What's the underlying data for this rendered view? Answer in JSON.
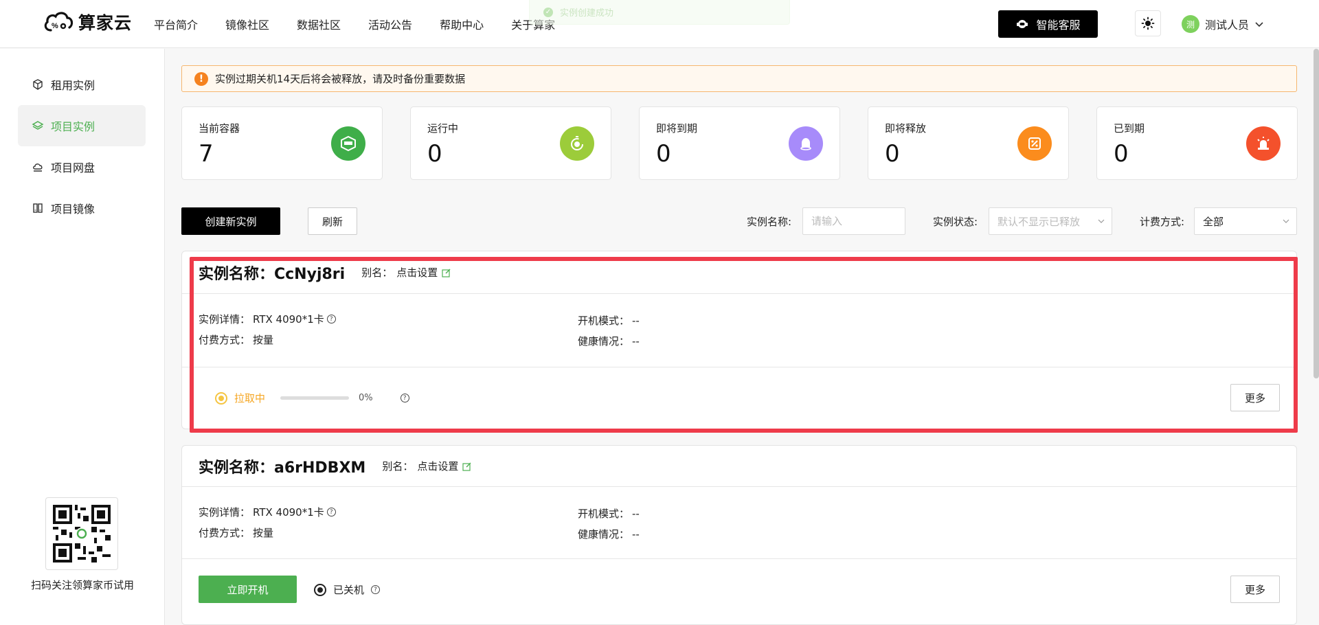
{
  "header": {
    "logo_text": "算家云",
    "nav": [
      "平台简介",
      "镜像社区",
      "数据社区",
      "活动公告",
      "帮助中心",
      "关于算家"
    ],
    "toast_text": "实例创建成功",
    "service_label": "智能客服",
    "user": {
      "avatar_text": "测",
      "name": "测试人员"
    }
  },
  "sidebar": {
    "items": [
      {
        "label": "租用实例",
        "icon": "cube-icon"
      },
      {
        "label": "项目实例",
        "icon": "layers-icon"
      },
      {
        "label": "项目网盘",
        "icon": "cloud-disk-icon"
      },
      {
        "label": "项目镜像",
        "icon": "image-stack-icon"
      }
    ],
    "qr_caption": "扫码关注领算家币试用"
  },
  "notice": "实例过期关机14天后将会被释放，请及时备份重要数据",
  "stats": [
    {
      "label": "当前容器",
      "value": "7",
      "color": "#3fae49"
    },
    {
      "label": "运行中",
      "value": "0",
      "color": "#9ccc3a"
    },
    {
      "label": "即将到期",
      "value": "0",
      "color": "#a78bfa"
    },
    {
      "label": "即将释放",
      "value": "0",
      "color": "#fb8c1d"
    },
    {
      "label": "已到期",
      "value": "0",
      "color": "#f4512c"
    }
  ],
  "toolbar": {
    "create_label": "创建新实例",
    "refresh_label": "刷新",
    "name_label": "实例名称:",
    "name_placeholder": "请输入",
    "status_label": "实例状态:",
    "status_placeholder": "默认不显示已释放",
    "billing_label": "计费方式:",
    "billing_value": "全部"
  },
  "instances": [
    {
      "title": "实例名称：CcNyj8ri",
      "alias_label": "别名：",
      "alias_link": "点击设置",
      "detail_label": "实例详情：",
      "detail_value": "RTX 4090*1卡",
      "pay_label": "付费方式：",
      "pay_value": "按量",
      "boot_label": "开机模式：",
      "boot_value": "--",
      "health_label": "健康情况：",
      "health_value": "--",
      "status": "拉取中",
      "progress_text": "0%",
      "progress": 0,
      "more_label": "更多"
    },
    {
      "title": "实例名称：a6rHDBXM",
      "alias_label": "别名：",
      "alias_link": "点击设置",
      "detail_label": "实例详情：",
      "detail_value": "RTX 4090*1卡",
      "pay_label": "付费方式：",
      "pay_value": "按量",
      "boot_label": "开机模式：",
      "boot_value": "--",
      "health_label": "健康情况：",
      "health_value": "--",
      "start_label": "立即开机",
      "status": "已关机",
      "more_label": "更多"
    }
  ]
}
